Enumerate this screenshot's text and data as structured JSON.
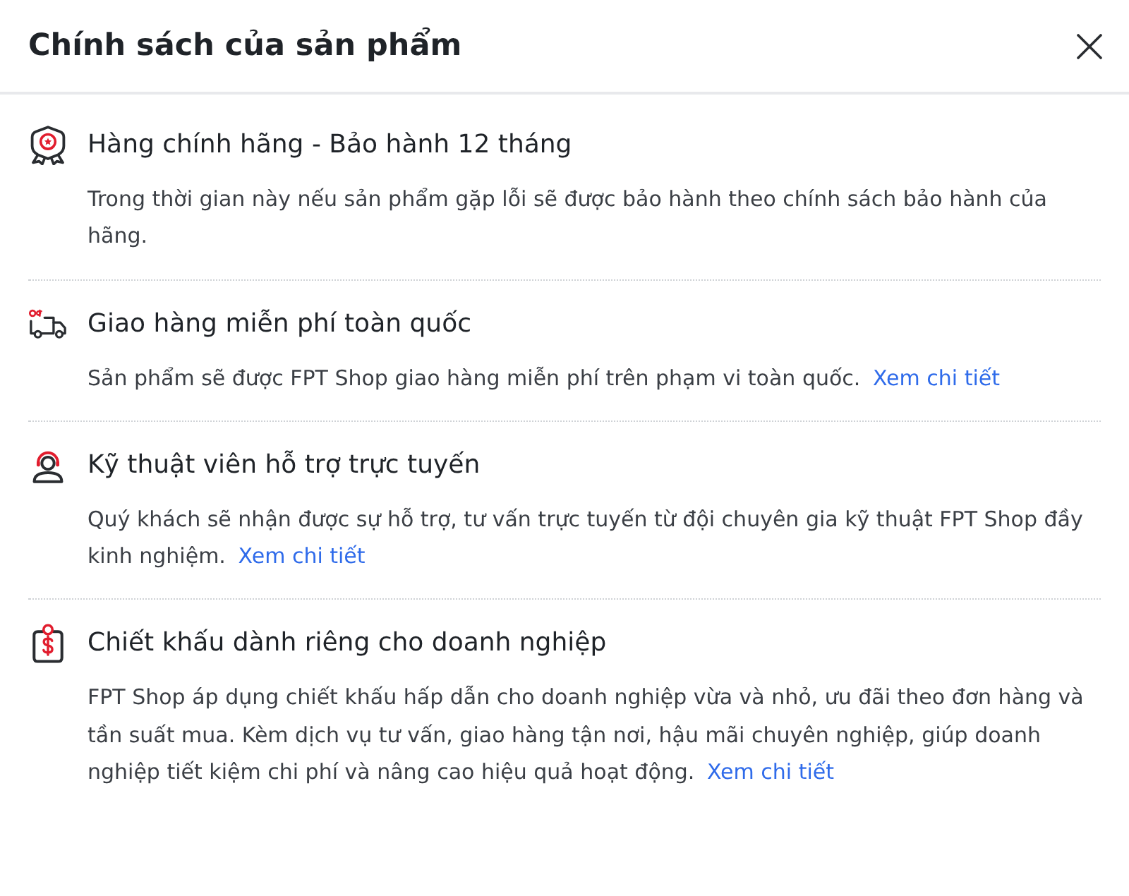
{
  "dialog": {
    "title": "Chính sách của sản phẩm"
  },
  "policies": [
    {
      "kind": "warranty",
      "title": "Hàng chính hãng - Bảo hành 12 tháng",
      "description": "Trong thời gian này nếu sản phẩm gặp lỗi sẽ được bảo hành theo chính sách bảo hành của hãng."
    },
    {
      "kind": "shipping",
      "title": "Giao hàng miễn phí toàn quốc",
      "description": "Sản phẩm sẽ được FPT Shop giao hàng miễn phí trên phạm vi toàn quốc.",
      "link": "Xem chi tiết"
    },
    {
      "kind": "support",
      "title": "Kỹ thuật viên hỗ trợ trực tuyến",
      "description": "Quý khách sẽ nhận được sự hỗ trợ, tư vấn trực tuyến từ đội chuyên gia kỹ thuật FPT Shop đầy kinh nghiệm.",
      "link": "Xem chi tiết"
    },
    {
      "kind": "business",
      "title": "Chiết khấu dành riêng cho doanh nghiệp",
      "description": "FPT Shop áp dụng chiết khấu hấp dẫn cho doanh nghiệp vừa và nhỏ, ưu đãi theo đơn hàng và tần suất mua. Kèm dịch vụ tư vấn, giao hàng tận nơi, hậu mãi chuyên nghiệp, giúp doanh nghiệp tiết kiệm chi phí và nâng cao hiệu quả hoạt động.",
      "link": "Xem chi tiết"
    }
  ]
}
